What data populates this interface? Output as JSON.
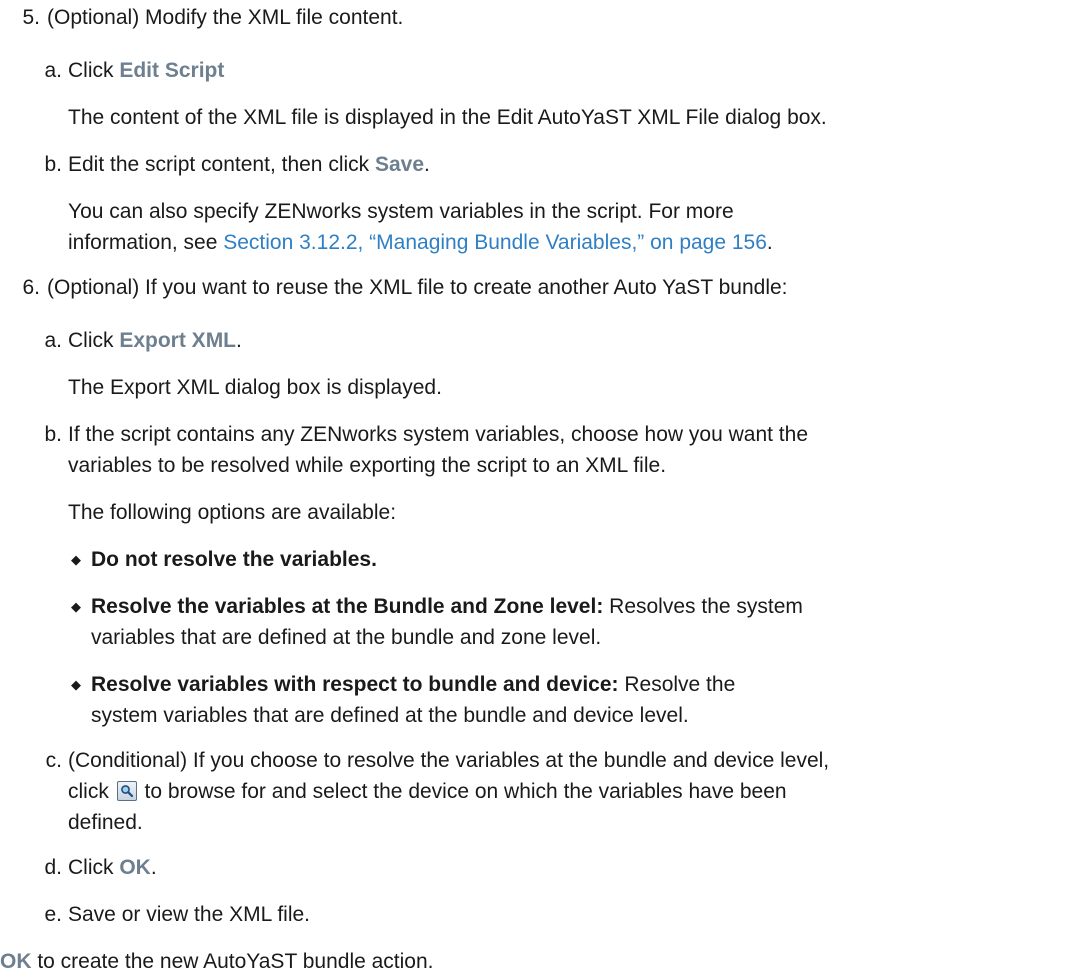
{
  "step5": {
    "number": "5.",
    "text": "(Optional) Modify the XML file content.",
    "a": {
      "letter": "a.",
      "text_pre": "Click ",
      "ui": "Edit Script",
      "result": "The content of the XML file is displayed in the Edit AutoYaST XML File dialog box."
    },
    "b": {
      "letter": "b.",
      "text_pre": "Edit the script content, then click ",
      "ui": "Save",
      "text_post": ".",
      "note_pre": "You can also specify ZENworks system variables in the script. For more",
      "note_line2_pre": "information, see ",
      "link": "Section 3.12.2, “Managing Bundle Variables,” on page 156",
      "note_post": "."
    }
  },
  "step6": {
    "number": "6.",
    "text": "(Optional) If you want to reuse the XML file to create another Auto YaST bundle:",
    "a": {
      "letter": "a.",
      "text_pre": "Click ",
      "ui": "Export XML",
      "text_post": ".",
      "result": "The Export XML dialog box is displayed."
    },
    "b": {
      "letter": "b.",
      "line1": "If the script contains any ZENworks system variables, choose how you want the",
      "line2": "variables to be resolved while exporting the script to an XML file.",
      "options_intro": "The following options are available:",
      "options": [
        {
          "bold": "Do not resolve the variables.",
          "line1": "",
          "line2": ""
        },
        {
          "bold": "Resolve the variables at the Bundle and Zone level:",
          "line1": " Resolves the system",
          "line2": "variables that are defined at the bundle and zone level."
        },
        {
          "bold": "Resolve variables with respect to bundle and device:",
          "line1": " Resolve the",
          "line2": "system variables that are defined at the bundle and device level."
        }
      ]
    },
    "c": {
      "letter": "c.",
      "line1": "(Conditional) If you choose to resolve the variables at the bundle and device level,",
      "line2_pre": "click ",
      "line2_post": " to browse for and select the device on which the variables have been",
      "line3": "defined.",
      "icon": "browse-search-icon"
    },
    "d": {
      "letter": "d.",
      "text_pre": "Click ",
      "ui": "OK",
      "text_post": "."
    },
    "e": {
      "letter": "e.",
      "text": "Save or view the XML file."
    }
  },
  "final": {
    "ui": "OK",
    "text": " to create the new AutoYaST bundle action."
  },
  "colors": {
    "ui_label": "#6e7f8f",
    "link": "#2f7fc4",
    "text": "#1a1a1a"
  }
}
